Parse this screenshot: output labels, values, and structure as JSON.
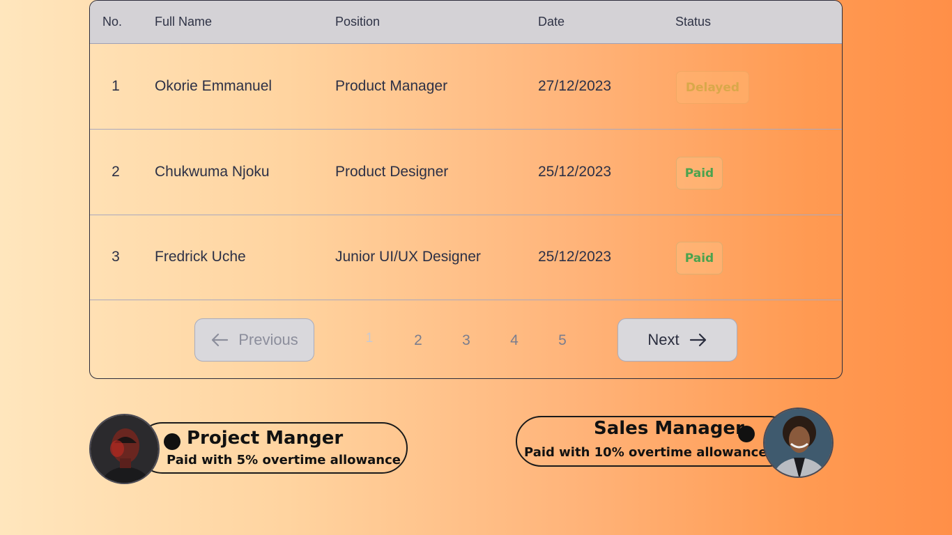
{
  "table": {
    "headers": [
      "No.",
      "Full Name",
      "Position",
      "Date",
      "Status"
    ],
    "rows": [
      {
        "no": "1",
        "name": "Okorie Emmanuel",
        "position": "Product Manager",
        "date": "27/12/2023",
        "status": "Delayed"
      },
      {
        "no": "2",
        "name": "Chukwuma Njoku",
        "position": "Product Designer",
        "date": "25/12/2023",
        "status": "Paid"
      },
      {
        "no": "3",
        "name": "Fredrick Uche",
        "position": "Junior UI/UX Designer",
        "date": "25/12/2023",
        "status": "Paid"
      }
    ]
  },
  "pagination": {
    "previous_label": "Previous",
    "next_label": "Next",
    "pages": [
      "1",
      "2",
      "3",
      "4",
      "5"
    ],
    "current_page": "1"
  },
  "cards": [
    {
      "title": "Project Manger",
      "subtitle": "Paid with 5% overtime  allowance",
      "avatar": "man-portrait-avatar"
    },
    {
      "title": "Sales Manager",
      "subtitle": "Paid with 10% overtime allowance",
      "avatar": "woman-portrait-avatar"
    }
  ],
  "colors": {
    "delayed": "#d9a84a",
    "paid": "#4ba34e",
    "header_bg": "#d4d2d6"
  }
}
